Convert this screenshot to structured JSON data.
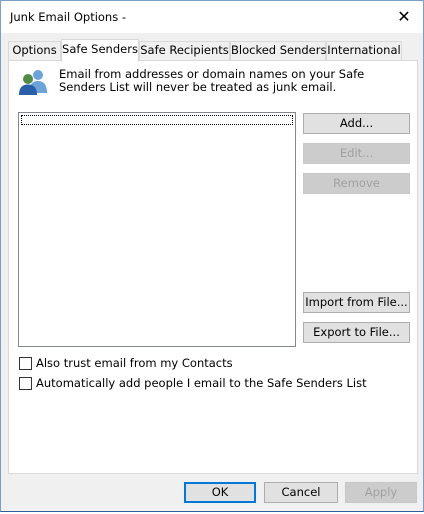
{
  "window": {
    "title": "Junk Email Options -",
    "close_glyph": "✕"
  },
  "tabs": [
    {
      "label": "Options",
      "active": false
    },
    {
      "label": "Safe Senders",
      "active": true
    },
    {
      "label": "Safe Recipients",
      "active": false
    },
    {
      "label": "Blocked Senders",
      "active": false
    },
    {
      "label": "International",
      "active": false
    }
  ],
  "panel": {
    "icon": "people-icon",
    "description": "Email from addresses or domain names on your Safe Senders List will never be treated as junk email.",
    "list_items": [],
    "buttons": {
      "add": "Add...",
      "edit": "Edit...",
      "remove": "Remove",
      "import": "Import from File...",
      "export": "Export to File..."
    },
    "checkboxes": {
      "trust_contacts": {
        "label": "Also trust email from my Contacts",
        "checked": false
      },
      "auto_add": {
        "label": "Automatically add people I email to the Safe Senders List",
        "checked": false
      }
    }
  },
  "footer": {
    "ok": "OK",
    "cancel": "Cancel",
    "apply": "Apply"
  }
}
